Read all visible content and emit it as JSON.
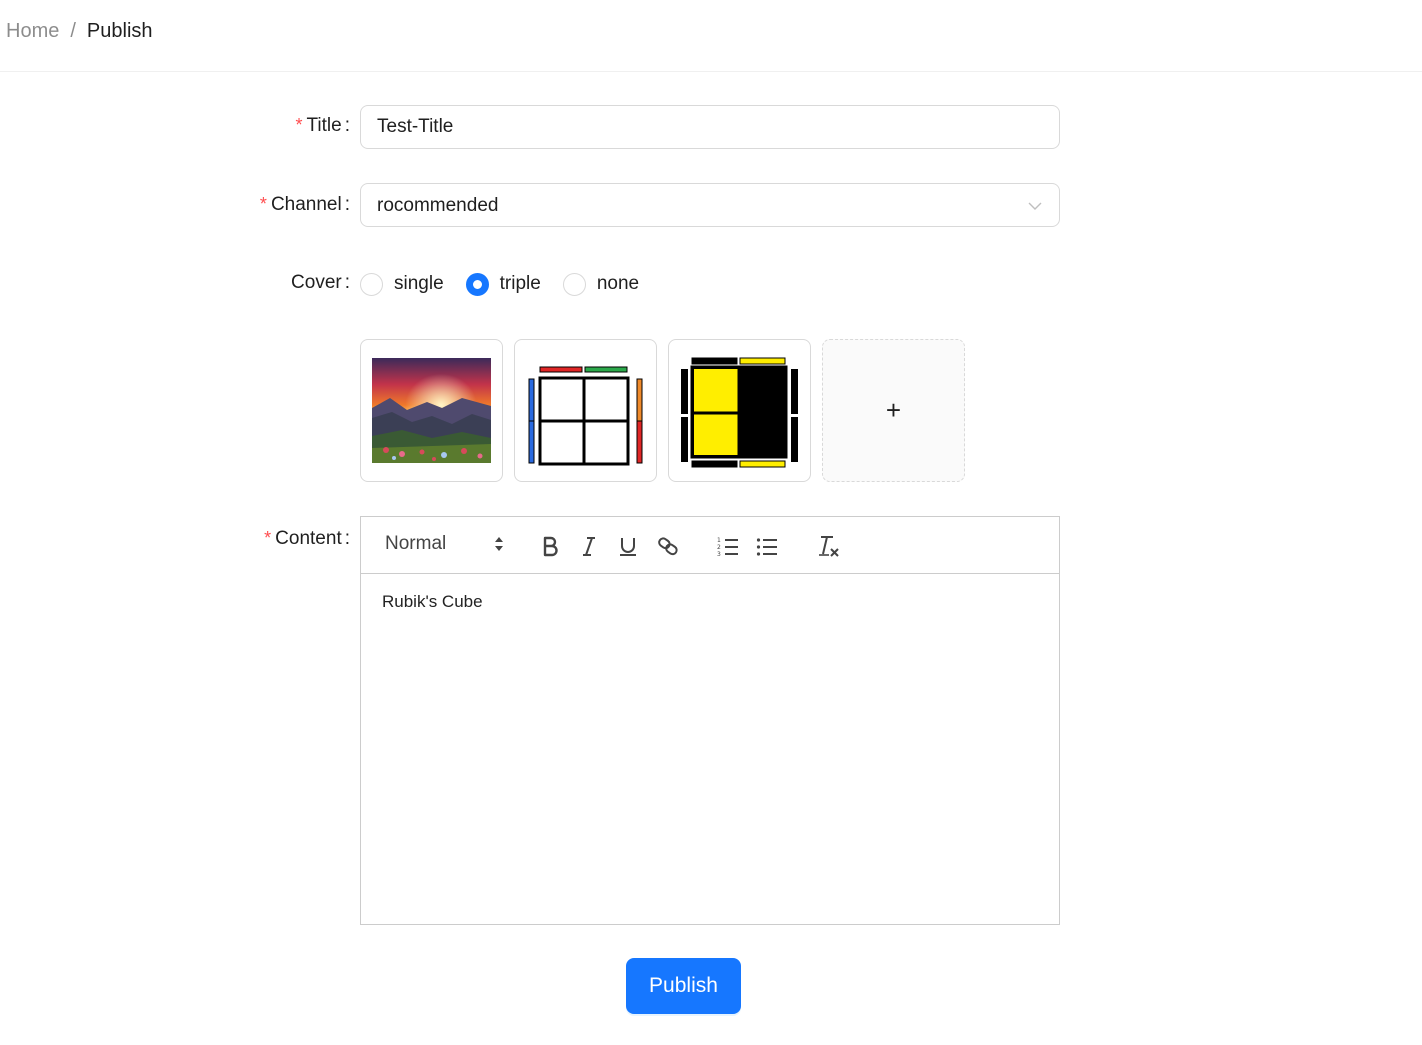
{
  "breadcrumb": {
    "home": "Home",
    "separator": "/",
    "current": "Publish"
  },
  "form": {
    "title": {
      "label": "Title",
      "value": "Test-Title",
      "required": true
    },
    "channel": {
      "label": "Channel",
      "value": "rocommended",
      "required": true
    },
    "cover": {
      "label": "Cover",
      "options": [
        "single",
        "triple",
        "none"
      ],
      "selected": "triple",
      "images": [
        "sunset-landscape-image",
        "rubiks-cube-diagram-image",
        "rubiks-cube-yellow-image"
      ],
      "add_label": "+"
    },
    "content": {
      "label": "Content",
      "required": true,
      "header_select": "Normal",
      "text": "Rubik's Cube"
    }
  },
  "actions": {
    "publish_label": "Publish"
  },
  "colors": {
    "accent": "#1677ff",
    "required": "#ff4d4f"
  }
}
